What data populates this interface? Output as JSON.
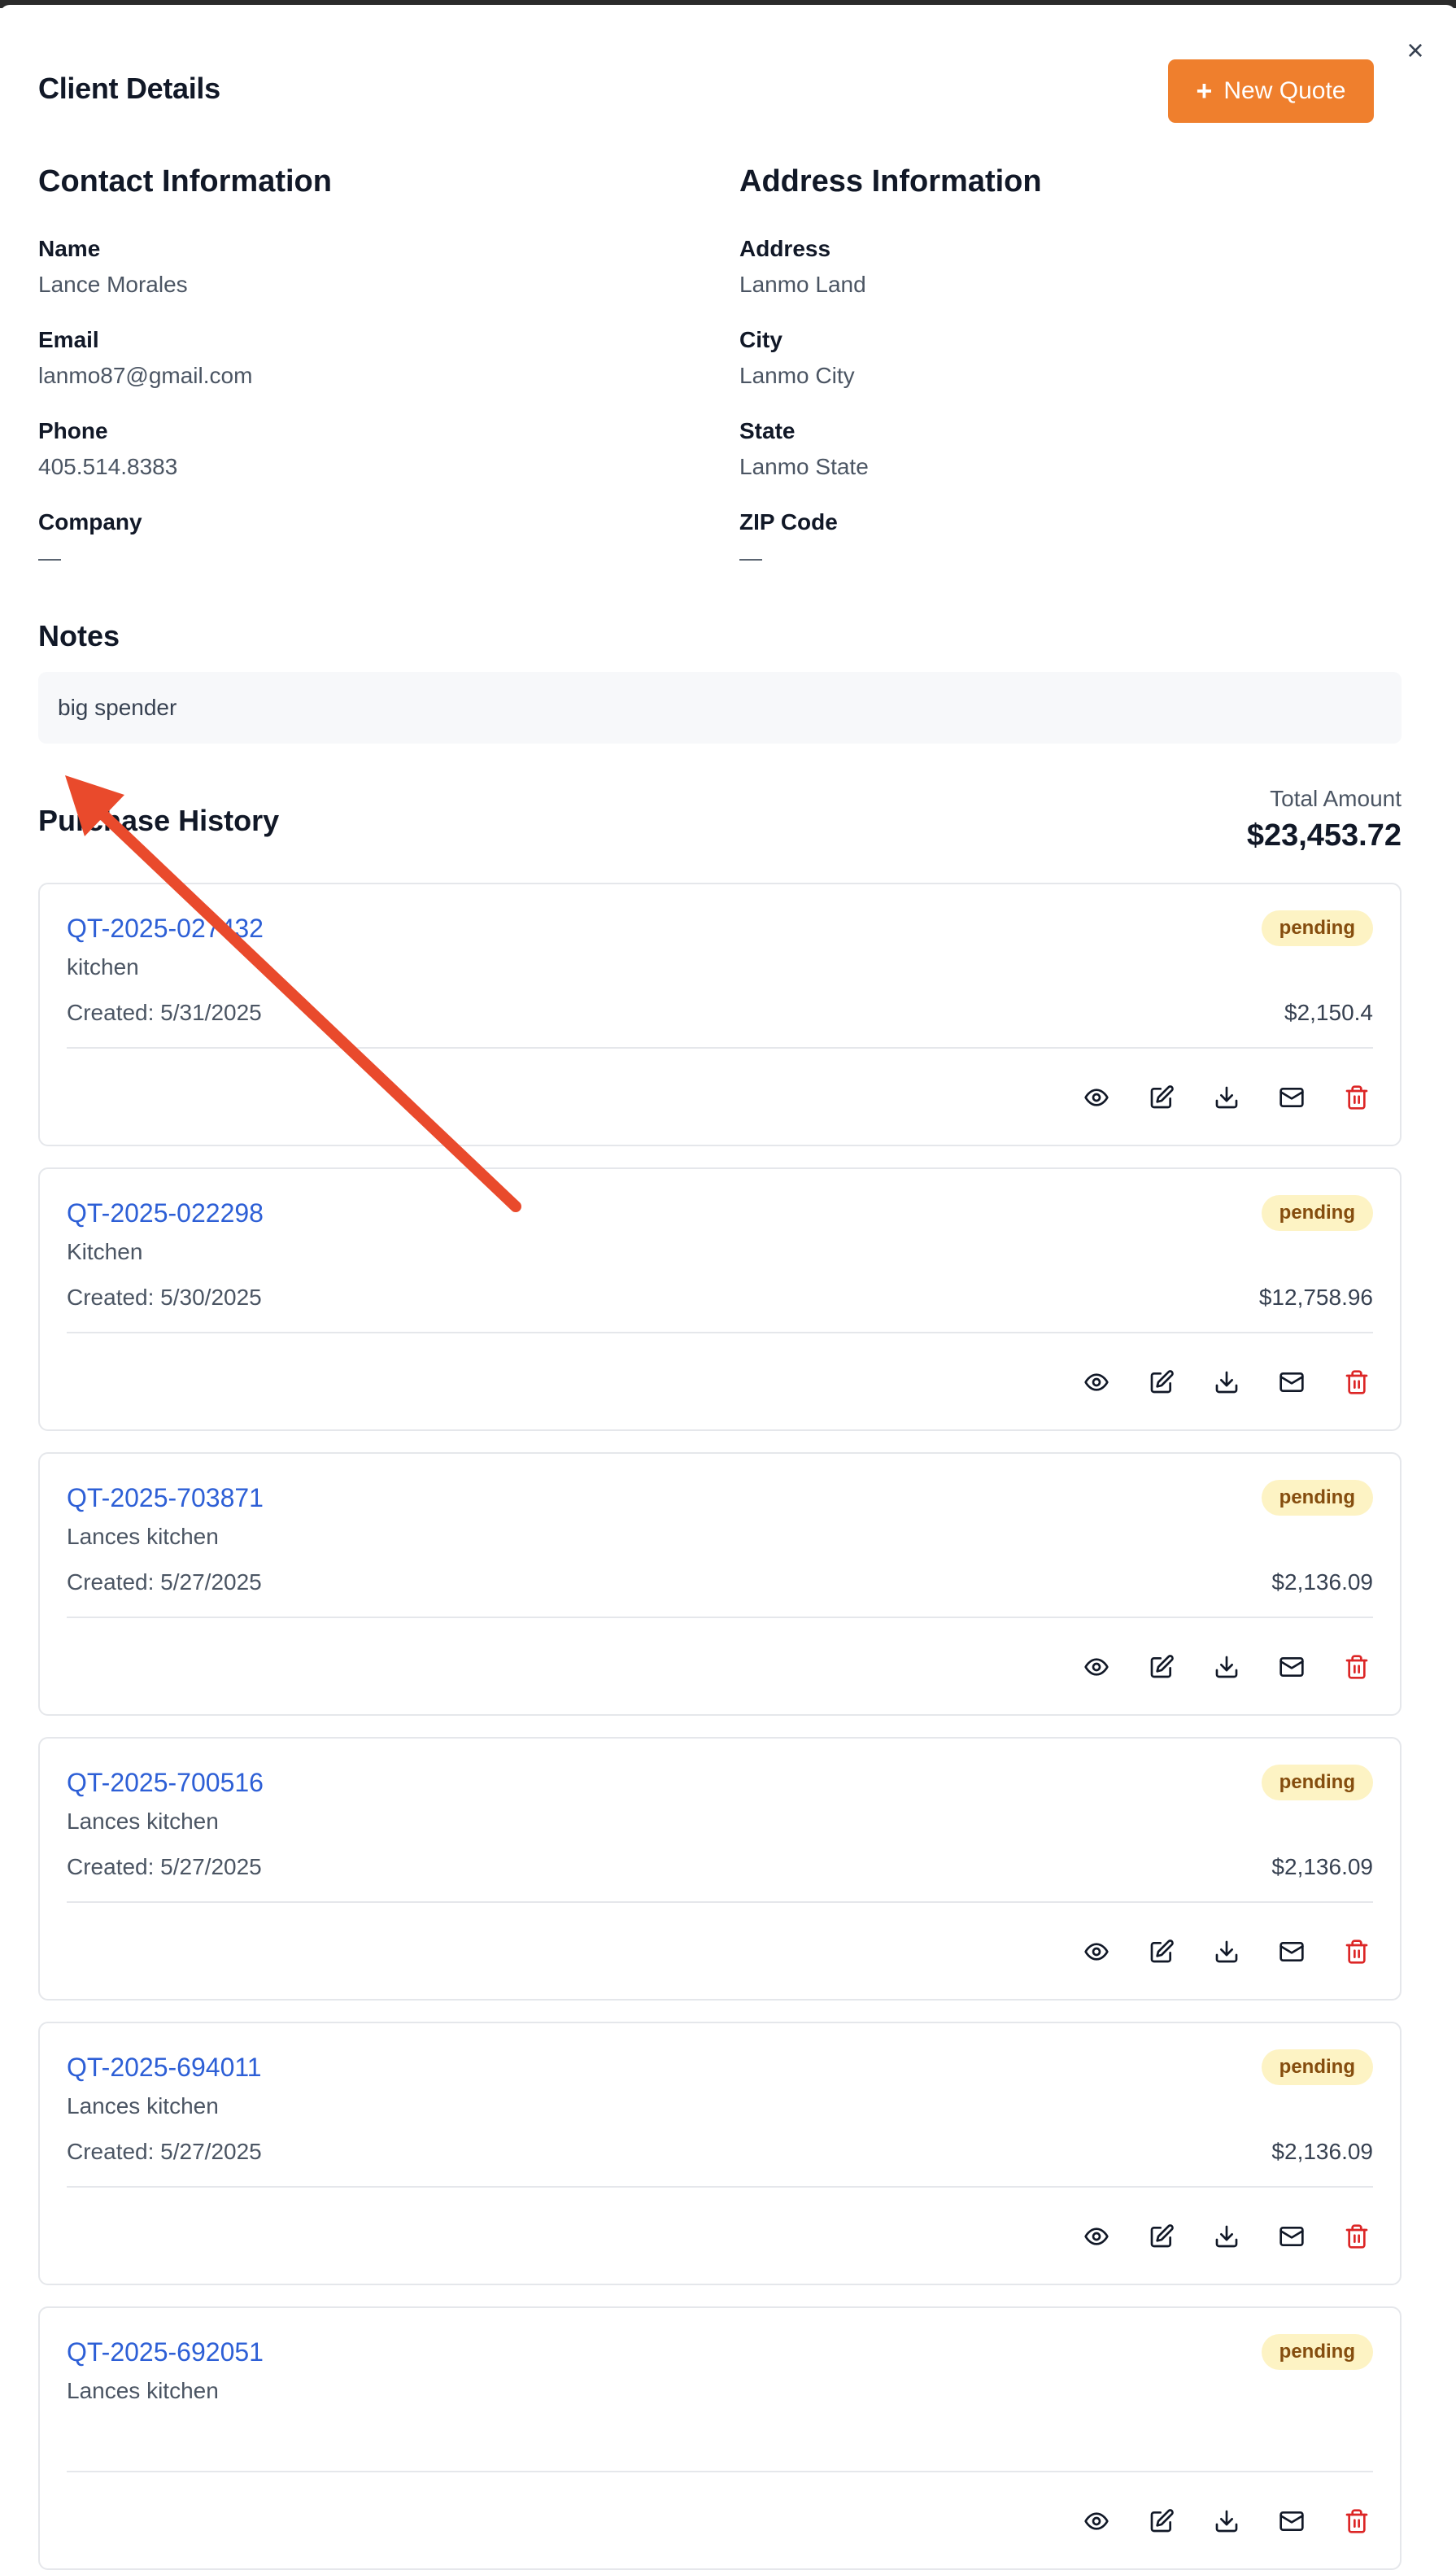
{
  "modal": {
    "title": "Client Details",
    "new_quote_label": "New Quote",
    "close_glyph": "×"
  },
  "contact": {
    "heading": "Contact Information",
    "fields": [
      {
        "label": "Name",
        "value": "Lance Morales"
      },
      {
        "label": "Email",
        "value": "lanmo87@gmail.com"
      },
      {
        "label": "Phone",
        "value": "405.514.8383"
      },
      {
        "label": "Company",
        "value": "—"
      }
    ]
  },
  "address": {
    "heading": "Address Information",
    "fields": [
      {
        "label": "Address",
        "value": "Lanmo Land"
      },
      {
        "label": "City",
        "value": "Lanmo City"
      },
      {
        "label": "State",
        "value": "Lanmo State"
      },
      {
        "label": "ZIP Code",
        "value": "—"
      }
    ]
  },
  "notes": {
    "heading": "Notes",
    "text": "big spender"
  },
  "history": {
    "heading": "Purchase History",
    "total_label": "Total Amount",
    "total_value": "$23,453.72",
    "quotes": [
      {
        "id": "QT-2025-027432",
        "desc": "kitchen",
        "created": "Created: 5/31/2025",
        "amount": "$2,150.4",
        "status": "pending"
      },
      {
        "id": "QT-2025-022298",
        "desc": "Kitchen",
        "created": "Created: 5/30/2025",
        "amount": "$12,758.96",
        "status": "pending"
      },
      {
        "id": "QT-2025-703871",
        "desc": "Lances kitchen",
        "created": "Created: 5/27/2025",
        "amount": "$2,136.09",
        "status": "pending"
      },
      {
        "id": "QT-2025-700516",
        "desc": "Lances kitchen",
        "created": "Created: 5/27/2025",
        "amount": "$2,136.09",
        "status": "pending"
      },
      {
        "id": "QT-2025-694011",
        "desc": "Lances kitchen",
        "created": "Created: 5/27/2025",
        "amount": "$2,136.09",
        "status": "pending"
      },
      {
        "id": "QT-2025-692051",
        "desc": "Lances kitchen",
        "created": "",
        "amount": "",
        "status": "pending"
      }
    ]
  },
  "icons": {
    "actions": [
      "eye-icon",
      "edit-icon",
      "download-icon",
      "mail-icon",
      "trash-icon"
    ]
  },
  "colors": {
    "accent": "#ef7f2d",
    "link": "#2d5fd6",
    "badge_bg": "#fdf3c4",
    "badge_text": "#854d0e",
    "danger": "#dc2626",
    "annotation_arrow": "#e94a2c"
  }
}
